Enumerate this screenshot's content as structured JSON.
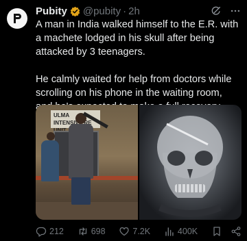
{
  "post": {
    "author_name": "Pubity",
    "author_handle": "@pubity",
    "separator": "·",
    "timestamp": "2h",
    "paragraphs": [
      "A man in India walked himself to the E.R. with a machete lodged in his skull after being attacked by 3 teenagers.",
      "He calmly waited for help from doctors while scrolling on his phone in the waiting room, and he's expected to make a full recovery."
    ],
    "media": {
      "left_sign_text": "ULMA INTENSIVE RE UNIT"
    }
  },
  "actions": {
    "replies": "212",
    "reposts": "698",
    "likes": "7.2K",
    "views": "400K"
  },
  "colors": {
    "background": "#000000",
    "text": "#e7e9ea",
    "muted": "#71767b",
    "verified_badge": "#e2a318"
  },
  "icons": {
    "avatar": "pubity-logo",
    "verified": "verified-badge-icon",
    "grok": "grok-icon",
    "more": "more-icon",
    "reply": "reply-icon",
    "repost": "repost-icon",
    "like": "heart-icon",
    "views": "views-icon",
    "bookmark": "bookmark-icon",
    "share": "share-icon"
  }
}
